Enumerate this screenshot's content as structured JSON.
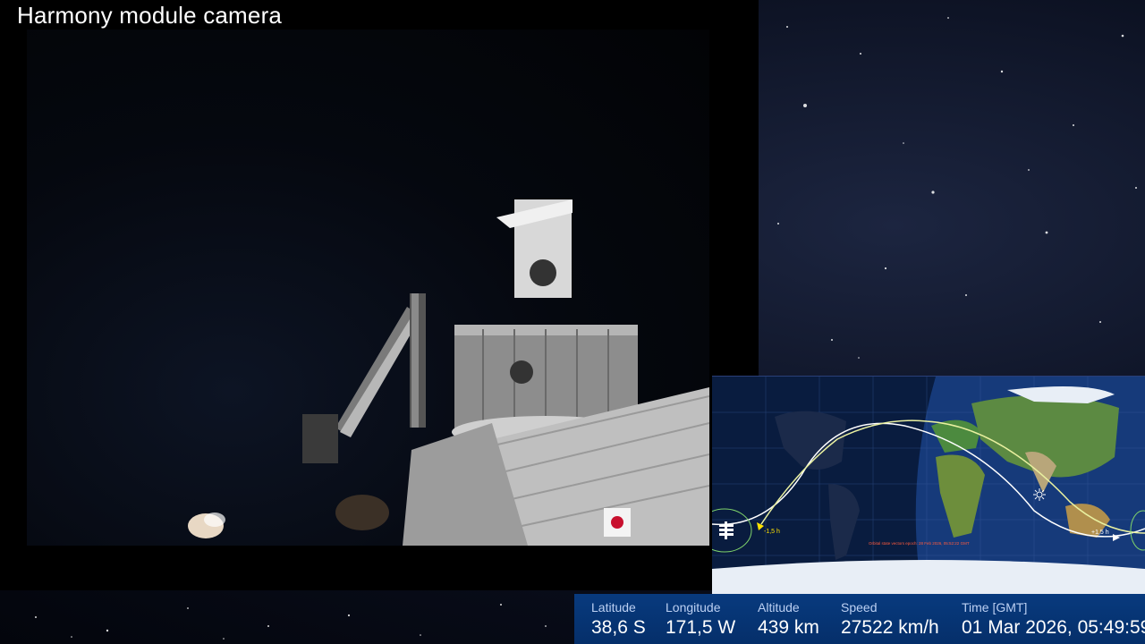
{
  "camera": {
    "title": "Harmony module camera"
  },
  "map": {
    "marker_minus": "-1,5 h",
    "marker_plus": "+1,5 h",
    "orbital_note": "Orbital state vectors epoch: 28 Feb 2026, 05:52:22 GMT"
  },
  "telemetry": {
    "latitude_label": "Latitude",
    "latitude_value": "38,6 S",
    "longitude_label": "Longitude",
    "longitude_value": "171,5 W",
    "altitude_label": "Altitude",
    "altitude_value": "439 km",
    "speed_label": "Speed",
    "speed_value": "27522 km/h",
    "time_label": "Time [GMT]",
    "time_value": "01 Mar 2026, 05:49:59"
  },
  "colors": {
    "info_bar": "#063578",
    "orbit_current": "#e9f0a0",
    "orbit_next": "#ffffff",
    "ocean": "#1c4f9a",
    "land": "#3f7e3a"
  }
}
